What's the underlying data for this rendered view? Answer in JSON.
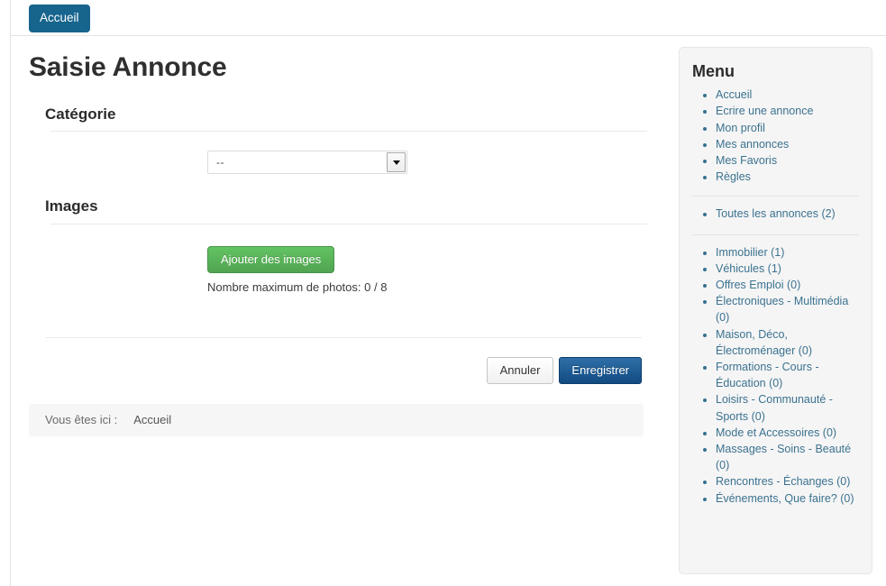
{
  "topnav": {
    "home_label": "Accueil"
  },
  "page": {
    "title": "Saisie Annonce"
  },
  "form": {
    "category": {
      "heading": "Catégorie",
      "selected_value": "--",
      "options": [
        "--"
      ]
    },
    "images": {
      "heading": "Images",
      "add_button_label": "Ajouter des images",
      "photo_count_text": "Nombre maximum de photos: 0 / 8"
    },
    "actions": {
      "cancel_label": "Annuler",
      "save_label": "Enregistrer"
    }
  },
  "breadcrumb": {
    "prefix": "Vous êtes ici :",
    "current": "Accueil"
  },
  "sidebar": {
    "title": "Menu",
    "primary_items": [
      {
        "label": "Accueil"
      },
      {
        "label": "Ecrire une annonce"
      },
      {
        "label": "Mon profil"
      },
      {
        "label": "Mes annonces"
      },
      {
        "label": "Mes Favoris"
      },
      {
        "label": "Règles"
      }
    ],
    "all_items": [
      {
        "label": "Toutes les annonces (2)"
      }
    ],
    "categories": [
      {
        "label": "Immobilier (1)"
      },
      {
        "label": "Véhicules (1)"
      },
      {
        "label": "Offres Emploi (0)"
      },
      {
        "label": "Électroniques - Multimédia (0)"
      },
      {
        "label": "Maison, Déco, Électroménager (0)"
      },
      {
        "label": "Formations - Cours - Éducation (0)"
      },
      {
        "label": "Loisirs - Communauté - Sports (0)"
      },
      {
        "label": "Mode et Accessoires (0)"
      },
      {
        "label": "Massages - Soins - Beauté (0)"
      },
      {
        "label": "Rencontres - Échanges (0)"
      },
      {
        "label": "Événements, Que faire? (0)"
      }
    ]
  },
  "colors": {
    "nav_button": "#17648d",
    "save_button": "#2f6fa8",
    "add_images_button": "#62c462",
    "link": "#3b7290",
    "sidebar_bg": "#f5f5f5"
  }
}
